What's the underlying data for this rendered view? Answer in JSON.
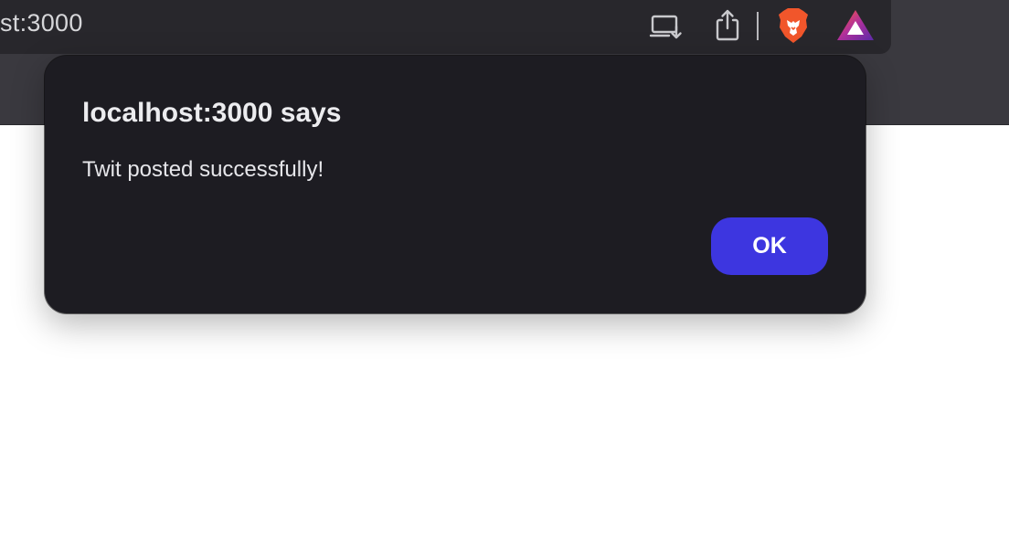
{
  "browser": {
    "url_fragment": "st:3000",
    "icons": {
      "install": "install-app-icon",
      "share": "share-icon",
      "brave": "brave-shields-icon",
      "rewards": "brave-rewards-icon"
    },
    "colors": {
      "toolbar": "#3a393f",
      "address_bar": "#28272c",
      "brave_orange": "#f1562b",
      "rewards_purple": "#6b2fa8"
    }
  },
  "dialog": {
    "title": "localhost:3000 says",
    "message": "Twit posted successfully!",
    "ok_label": "OK",
    "colors": {
      "background": "#1d1c22",
      "button": "#3d36e0"
    }
  }
}
